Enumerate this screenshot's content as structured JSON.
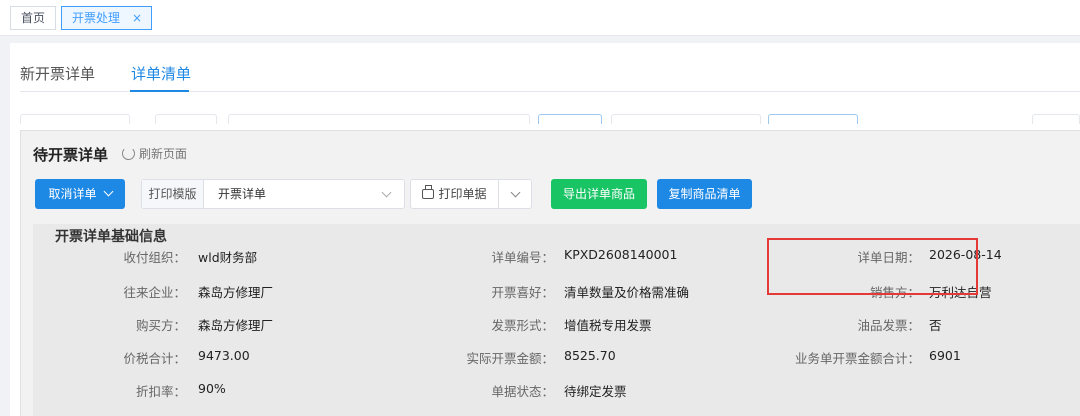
{
  "topbar": {
    "home_tab": "首页",
    "active_tab": "开票处理",
    "close_glyph": "×"
  },
  "subtabs": [
    "新开票详单",
    "详单清单"
  ],
  "panel": {
    "title": "待开票详单",
    "refresh_label": "刷新页面"
  },
  "toolbar": {
    "cancel_label": "取消详单",
    "template_label": "打印模版",
    "template_value": "开票详单",
    "print_label": "打印单据",
    "export_label": "导出详单商品",
    "copy_label": "复制商品清单"
  },
  "colors": {
    "primary": "#1e88e5",
    "success": "#19c465",
    "highlight": "#e53935"
  },
  "info": {
    "title": "开票详单基础信息",
    "fields": {
      "pay_org": {
        "label": "收付组织：",
        "value": "wld财务部"
      },
      "detail_no": {
        "label": "详单编号：",
        "value": "KPXD2608140001"
      },
      "detail_date": {
        "label": "详单日期：",
        "value": "2026-08-14"
      },
      "partner": {
        "label": "往来企业：",
        "value": "森岛方修理厂"
      },
      "preference": {
        "label": "开票喜好：",
        "value": "清单数量及价格需准确"
      },
      "seller": {
        "label": "销售方：",
        "value": "万利达自营"
      },
      "buyer": {
        "label": "购买方：",
        "value": "森岛方修理厂"
      },
      "invoice_form": {
        "label": "发票形式：",
        "value": "增值税专用发票"
      },
      "oil_invoice": {
        "label": "油品发票：",
        "value": "否"
      },
      "tax_total": {
        "label": "价税合计：",
        "value": "9473.00"
      },
      "actual_amount": {
        "label": "实际开票金额：",
        "value": "8525.70"
      },
      "biz_total": {
        "label": "业务单开票金额合计：",
        "value": "6901"
      },
      "discount": {
        "label": "折扣率：",
        "value": "90%"
      },
      "status": {
        "label": "单据状态：",
        "value": "待绑定发票"
      }
    }
  }
}
